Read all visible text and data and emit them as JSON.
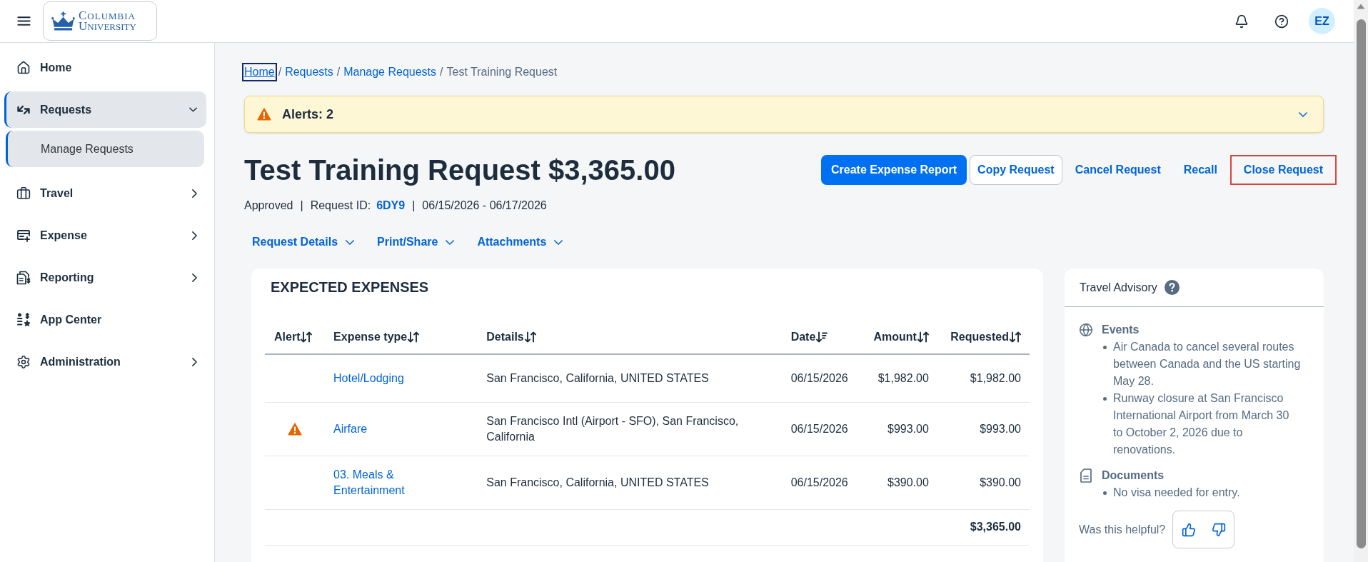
{
  "header": {
    "logo_lines": [
      "COLUMBIA",
      "UNIVERSITY"
    ],
    "avatar_initials": "EZ"
  },
  "sidebar": {
    "items": [
      {
        "label": "Home",
        "selected": false
      },
      {
        "label": "Requests",
        "selected": true,
        "expanded": true,
        "children": [
          {
            "label": "Manage Requests",
            "selected": true
          }
        ]
      },
      {
        "label": "Travel",
        "selected": false,
        "expanded": false
      },
      {
        "label": "Expense",
        "selected": false,
        "expanded": false
      },
      {
        "label": "Reporting",
        "selected": false,
        "expanded": false
      },
      {
        "label": "App Center",
        "selected": false
      },
      {
        "label": "Administration",
        "selected": false,
        "expanded": false
      }
    ]
  },
  "breadcrumb": [
    {
      "kind": "link",
      "text": "Home",
      "focused": true
    },
    {
      "kind": "separator",
      "text": "/"
    },
    {
      "kind": "link",
      "text": "Requests",
      "focused": false
    },
    {
      "kind": "separator",
      "text": "/"
    },
    {
      "kind": "link",
      "text": "Manage Requests",
      "focused": false
    },
    {
      "kind": "separator",
      "text": "/"
    },
    {
      "kind": "current",
      "text": "Test Training Request"
    }
  ],
  "alerts": {
    "label": "Alerts: 2",
    "expanded": false
  },
  "title": "Test Training Request $3,365.00",
  "actions": [
    {
      "label": "Create Expense Report",
      "kind": "primary",
      "highlighted": false
    },
    {
      "label": "Copy Request",
      "kind": "secondary",
      "highlighted": false
    },
    {
      "label": "Cancel Request",
      "kind": "link",
      "highlighted": false
    },
    {
      "label": "Recall",
      "kind": "link",
      "highlighted": false
    },
    {
      "label": "Close Request",
      "kind": "link",
      "highlighted": true
    }
  ],
  "summary": [
    {
      "kind": "status",
      "text": "Approved"
    },
    {
      "kind": "separator",
      "text": "|"
    },
    {
      "kind": "label",
      "text": "Request ID:"
    },
    {
      "kind": "id",
      "text": "6DY9"
    },
    {
      "kind": "separator",
      "text": "|"
    },
    {
      "kind": "dates",
      "text": "06/15/2026 - 06/17/2026"
    }
  ],
  "menus": [
    {
      "label": "Request Details",
      "expanded": false
    },
    {
      "label": "Print/Share",
      "expanded": false
    },
    {
      "label": "Attachments",
      "expanded": false
    }
  ],
  "expected_expenses": {
    "title": "EXPECTED EXPENSES",
    "columns": [
      {
        "label": "Alert",
        "sorted": false
      },
      {
        "label": "Expense type",
        "sorted": false
      },
      {
        "label": "Details",
        "sorted": false
      },
      {
        "label": "Date",
        "sorted": true
      },
      {
        "label": "Amount",
        "sorted": false
      },
      {
        "label": "Requested",
        "sorted": false
      }
    ],
    "rows": [
      {
        "alert": false,
        "expense_type": "Hotel/Lodging",
        "details": "San Francisco, California, UNITED STATES",
        "date": "06/15/2026",
        "amount": "$1,982.00",
        "requested": "$1,982.00"
      },
      {
        "alert": true,
        "expense_type": "Airfare",
        "details": "San Francisco Intl (Airport - SFO), San Francisco, California",
        "date": "06/15/2026",
        "amount": "$993.00",
        "requested": "$993.00"
      },
      {
        "alert": false,
        "expense_type": "03. Meals & Entertainment",
        "details": "San Francisco, California, UNITED STATES",
        "date": "06/15/2026",
        "amount": "$390.00",
        "requested": "$390.00"
      }
    ],
    "total": "$3,365.00"
  },
  "travel_advisory": {
    "title": "Travel Advisory",
    "sections": [
      {
        "heading": "Events",
        "items": [
          "Air Canada to cancel several routes between Canada and the US starting May 28.",
          "Runway closure at San Francisco International Airport from March 30 to October 2, 2026 due to renovations."
        ]
      },
      {
        "heading": "Documents",
        "items": [
          "No visa needed for entry."
        ]
      }
    ],
    "feedback_question": "Was this helpful?"
  }
}
